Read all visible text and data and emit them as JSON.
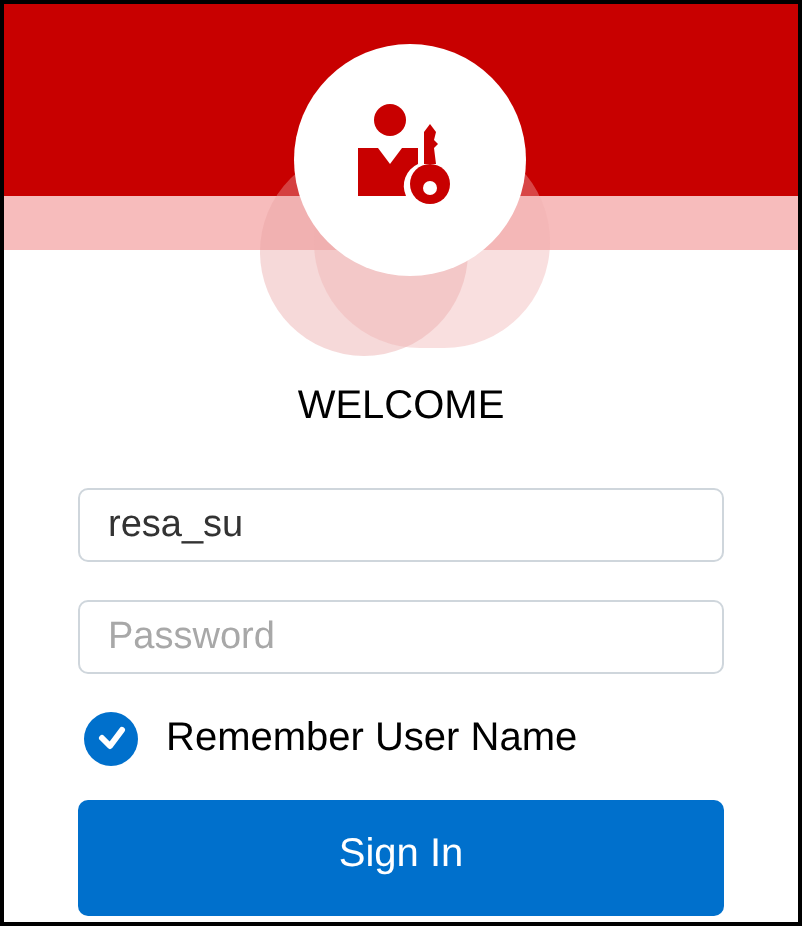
{
  "title": "WELCOME",
  "username": {
    "value": "resa_su"
  },
  "password": {
    "placeholder": "Password"
  },
  "remember": {
    "label": "Remember User Name",
    "checked": true
  },
  "sign_in": {
    "label": "Sign In"
  }
}
